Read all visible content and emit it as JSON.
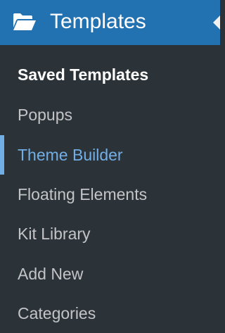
{
  "menu": {
    "title": "Templates",
    "icon": "folder-open-icon",
    "colors": {
      "header_bg": "#2271b1",
      "submenu_bg": "#2c3338",
      "active_text": "#ffffff",
      "focus_text": "#72aee6",
      "default_text": "#c3c4c7"
    },
    "items": [
      {
        "label": "Saved Templates",
        "state": "current"
      },
      {
        "label": "Popups",
        "state": "default"
      },
      {
        "label": "Theme Builder",
        "state": "hover"
      },
      {
        "label": "Floating Elements",
        "state": "default"
      },
      {
        "label": "Kit Library",
        "state": "default"
      },
      {
        "label": "Add New",
        "state": "default"
      },
      {
        "label": "Categories",
        "state": "default"
      }
    ]
  }
}
